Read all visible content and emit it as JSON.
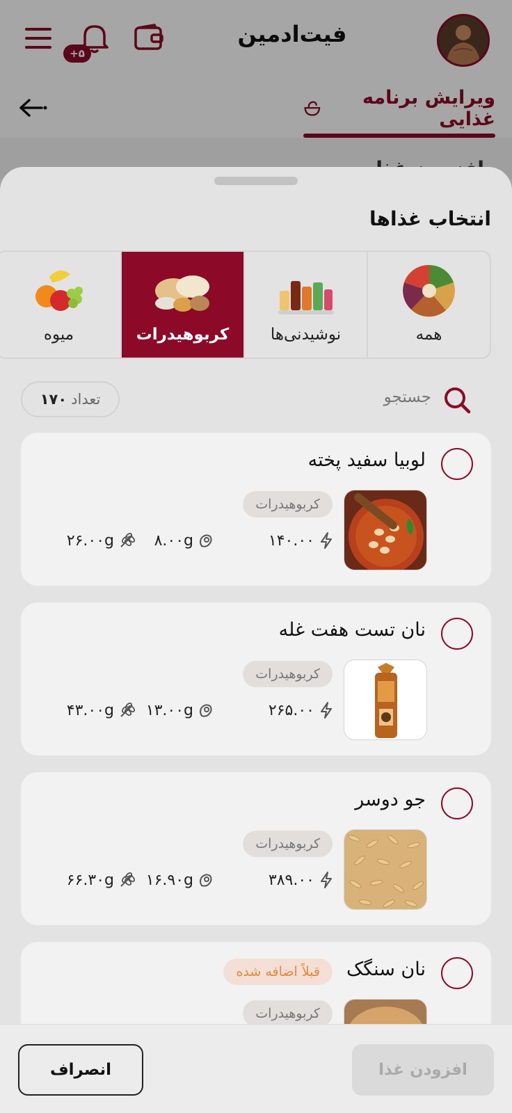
{
  "header": {
    "app_title": "فیت‌ادمین",
    "notification_count": "+۵"
  },
  "tabs": {
    "edit_tab_label": "ویرایش برنامه غذایی"
  },
  "background": {
    "subtitle_fragment": "افزودن غذا"
  },
  "sheet": {
    "title": "انتخاب غذاها",
    "categories": [
      {
        "label": "همه",
        "icon": "mixed-food-plate",
        "active": false
      },
      {
        "label": "نوشیدنی‌ها",
        "icon": "drinks",
        "active": false
      },
      {
        "label": "کربوهیدرات",
        "icon": "breads-grains",
        "active": true
      },
      {
        "label": "میوه",
        "icon": "fruits",
        "active": false
      }
    ],
    "search": {
      "placeholder": "جستجو"
    },
    "count": {
      "label": "تعداد",
      "value": "۱۷۰"
    }
  },
  "foods": [
    {
      "name": "لوبیا سفید پخته",
      "category": "کربوهیدرات",
      "energy": "۱۴۰.۰۰",
      "protein": "۸.۰۰g",
      "carbs": "۲۶.۰۰g",
      "image": "baked-beans-bowl"
    },
    {
      "name": "نان تست هفت غله",
      "category": "کربوهیدرات",
      "energy": "۲۶۵.۰۰",
      "protein": "۱۳.۰۰g",
      "carbs": "۴۳.۰۰g",
      "image": "bread-bag"
    },
    {
      "name": "جو دوسر",
      "category": "کربوهیدرات",
      "energy": "۳۸۹.۰۰",
      "protein": "۱۶.۹۰g",
      "carbs": "۶۶.۳۰g",
      "image": "oat-grains"
    },
    {
      "name": "نان سنگک",
      "category": "کربوهیدرات",
      "badge": "قبلاً اضافه شده",
      "image": "sangak-bread"
    }
  ],
  "actions": {
    "add_label": "افزودن غذا",
    "cancel_label": "انصراف"
  },
  "colors": {
    "primary": "#8c0a28",
    "added_badge_text": "#e6893b",
    "sheet_bg": "#e3e3e3",
    "card_bg": "#f2f2f2"
  }
}
